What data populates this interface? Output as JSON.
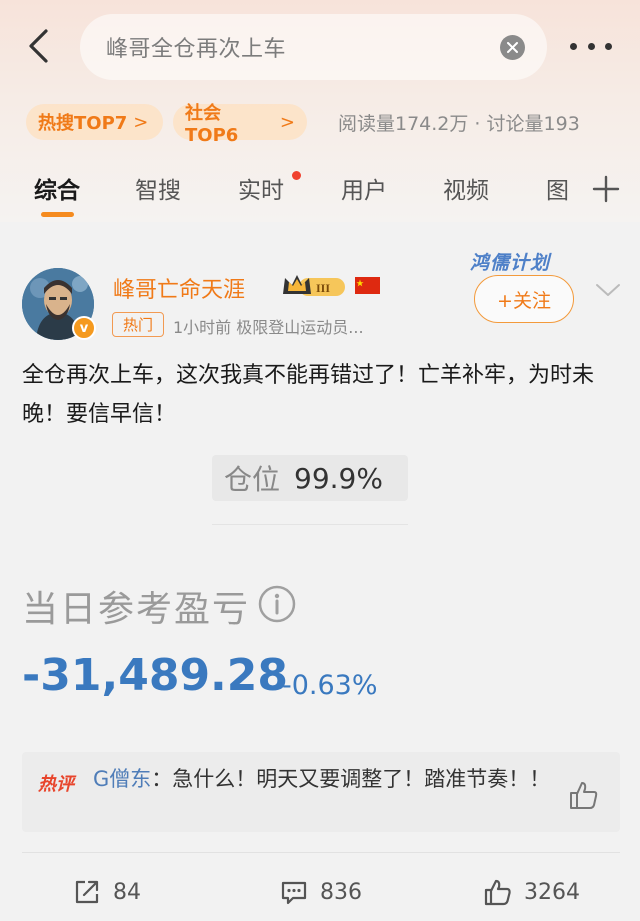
{
  "search": {
    "query": "峰哥全仓再次上车"
  },
  "chips": [
    {
      "label": "热搜TOP7",
      "arrow": ">"
    },
    {
      "label": "社会TOP6",
      "arrow": ">"
    }
  ],
  "stats": "阅读量174.2万 · 讨论量193",
  "tabs": [
    "综合",
    "智搜",
    "实时",
    "用户",
    "视频",
    "图"
  ],
  "post": {
    "username": "峰哥亡命天涯",
    "level": "III",
    "verified_mark": "v",
    "hot_tag": "热门",
    "meta": "1小时前  极限登山运动员...",
    "promo": "鸿儒计划",
    "follow_label": "+关注",
    "text": "全仓再次上车，这次我真不能再错过了！亡羊补牢，为时未晚！要信早信！",
    "position_label": "仓位",
    "position_value": "99.9%",
    "pnl_label": "当日参考盈亏",
    "pnl_value": "-31,489.28",
    "pnl_percent": "-0.63%"
  },
  "hot_comment": {
    "tag": "热评",
    "user": "G僧东",
    "text": "：急什么！明天又要调整了！踏准节奏！！"
  },
  "actions": {
    "reposts": "84",
    "comments": "836",
    "likes": "3264"
  },
  "colors": {
    "accent": "#f07a18",
    "loss_blue": "#3a79bf",
    "hot_red": "#e8452c"
  }
}
